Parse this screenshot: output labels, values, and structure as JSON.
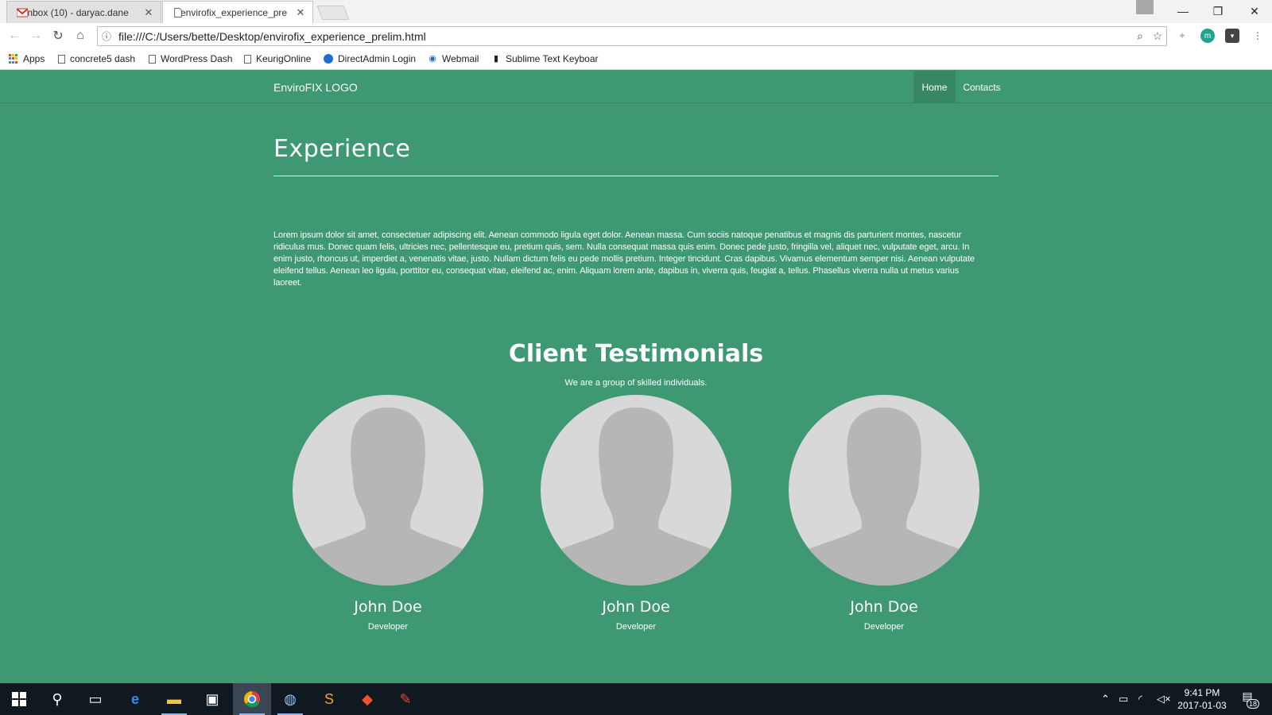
{
  "browser": {
    "tabs": [
      {
        "title": "Inbox (10) - daryac.dane",
        "active": false
      },
      {
        "title": "envirofix_experience_pre",
        "active": true
      }
    ],
    "url": "file:///C:/Users/bette/Desktop/envirofix_experience_prelim.html",
    "bookmarks": [
      "Apps",
      "concrete5 dash",
      "WordPress Dash",
      "KeurigOnline",
      "DirectAdmin Login",
      "Webmail",
      "Sublime Text Keyboar"
    ],
    "extension_m": "m"
  },
  "site": {
    "logo": "EnviroFIX LOGO",
    "nav": {
      "home": "Home",
      "contacts": "Contacts"
    },
    "experience": {
      "title": "Experience",
      "body": "Lorem ipsum dolor sit amet, consectetuer adipiscing elit. Aenean commodo ligula eget dolor. Aenean massa. Cum sociis natoque penatibus et magnis dis parturient montes, nascetur ridiculus mus. Donec quam felis, ultricies nec, pellentesque eu, pretium quis, sem. Nulla consequat massa quis enim. Donec pede justo, fringilla vel, aliquet nec, vulputate eget, arcu. In enim justo, rhoncus ut, imperdiet a, venenatis vitae, justo. Nullam dictum felis eu pede mollis pretium. Integer tincidunt. Cras dapibus. Vivamus elementum semper nisi. Aenean vulputate eleifend tellus. Aenean leo ligula, porttitor eu, consequat vitae, eleifend ac, enim. Aliquam lorem ante, dapibus in, viverra quis, feugiat a, tellus. Phasellus viverra nulla ut metus varius laoreet."
    },
    "testimonials": {
      "title": "Client Testimonials",
      "subtitle": "We are a group of skilled individuals.",
      "people": [
        {
          "name": "John Doe",
          "role": "Developer"
        },
        {
          "name": "John Doe",
          "role": "Developer"
        },
        {
          "name": "John Doe",
          "role": "Developer"
        }
      ]
    }
  },
  "taskbar": {
    "time": "9:41 PM",
    "date": "2017-01-03",
    "notifications": "18"
  },
  "colors": {
    "page_bg": "#3e9872",
    "nav_active_bg": "#378763",
    "avatar_bg": "#d8d8d8",
    "avatar_silhouette": "#b6b6b6",
    "taskbar_bg": "#101820"
  }
}
